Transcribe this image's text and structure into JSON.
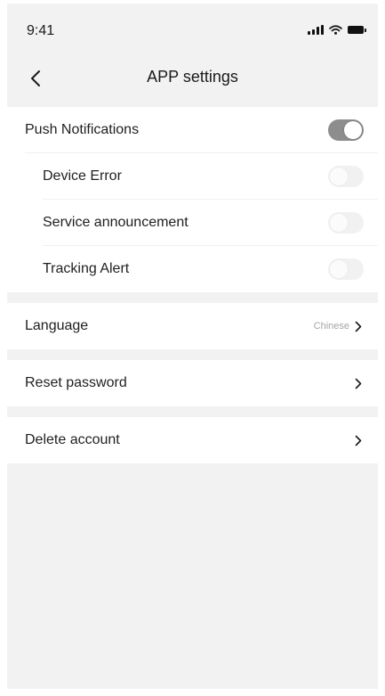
{
  "status_bar": {
    "time": "9:41"
  },
  "nav": {
    "title": "APP settings"
  },
  "notifications": {
    "push_label": "Push Notifications",
    "push_enabled": true,
    "items": [
      {
        "label": "Device Error",
        "enabled": false
      },
      {
        "label": "Service announcement",
        "enabled": false
      },
      {
        "label": "Tracking Alert",
        "enabled": false
      }
    ]
  },
  "language": {
    "label": "Language",
    "value": "Chinese"
  },
  "reset_password": {
    "label": "Reset password"
  },
  "delete_account": {
    "label": "Delete account"
  },
  "colors": {
    "background": "#f2f2f2",
    "card": "#ffffff",
    "toggle_on": "#8d8d8d",
    "toggle_off": "#f1f1f1",
    "secondary_text": "#a5a5a5"
  },
  "icons": {
    "back": "chevron-left-icon",
    "row_arrow": "chevron-right-icon",
    "signal": "cellular-signal-icon",
    "wifi": "wifi-icon",
    "battery": "battery-icon"
  }
}
